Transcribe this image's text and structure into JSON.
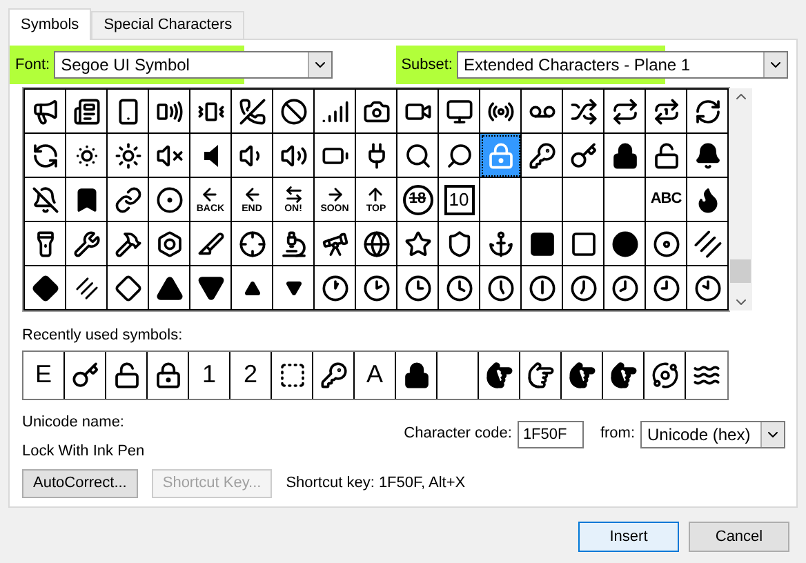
{
  "tabs": [
    {
      "label": "Symbols",
      "selected": true
    },
    {
      "label": "Special Characters",
      "selected": false
    }
  ],
  "font": {
    "label": "Font:",
    "value": "Segoe UI Symbol"
  },
  "subset": {
    "label": "Subset:",
    "value": "Extended Characters - Plane 1"
  },
  "symbol_grid": {
    "rows": [
      [
        {
          "kind": "icon",
          "selected": false
        },
        {
          "kind": "icon",
          "selected": false
        },
        {
          "kind": "icon",
          "selected": false
        },
        {
          "kind": "icon",
          "selected": false
        },
        {
          "kind": "icon",
          "selected": false
        },
        {
          "kind": "icon",
          "selected": false
        },
        {
          "kind": "icon",
          "selected": false
        },
        {
          "kind": "icon",
          "selected": false
        },
        {
          "kind": "icon",
          "selected": false
        },
        {
          "kind": "icon",
          "selected": false
        },
        {
          "kind": "icon",
          "selected": false
        },
        {
          "kind": "icon",
          "selected": false
        },
        {
          "kind": "icon",
          "selected": false
        },
        {
          "kind": "icon",
          "selected": false
        },
        {
          "kind": "icon",
          "selected": false
        },
        {
          "kind": "icon",
          "selected": false
        },
        {
          "kind": "icon",
          "selected": false
        }
      ],
      [
        {
          "kind": "icon",
          "selected": false
        },
        {
          "kind": "icon",
          "selected": false
        },
        {
          "kind": "icon",
          "selected": false
        },
        {
          "kind": "icon",
          "selected": false
        },
        {
          "kind": "icon",
          "selected": false
        },
        {
          "kind": "icon",
          "selected": false
        },
        {
          "kind": "icon",
          "selected": false
        },
        {
          "kind": "icon",
          "selected": false
        },
        {
          "kind": "icon",
          "selected": false
        },
        {
          "kind": "icon",
          "selected": false
        },
        {
          "kind": "icon",
          "selected": false
        },
        {
          "kind": "icon",
          "selected": true
        },
        {
          "kind": "icon",
          "selected": false
        },
        {
          "kind": "icon",
          "selected": false
        },
        {
          "kind": "icon",
          "selected": false
        },
        {
          "kind": "icon",
          "selected": false
        },
        {
          "kind": "icon",
          "selected": false
        }
      ],
      [
        {
          "kind": "icon",
          "selected": false
        },
        {
          "kind": "icon",
          "selected": false
        },
        {
          "kind": "icon",
          "selected": false
        },
        {
          "kind": "icon",
          "selected": false
        },
        {
          "kind": "arrow_text",
          "label": "BACK",
          "selected": false
        },
        {
          "kind": "arrow_text",
          "label": "END",
          "selected": false
        },
        {
          "kind": "arrow_text",
          "label": "ON!",
          "selected": false
        },
        {
          "kind": "arrow_text",
          "label": "SOON",
          "selected": false
        },
        {
          "kind": "arrow_text",
          "label": "TOP",
          "selected": false
        },
        {
          "kind": "circled_text",
          "label": "18",
          "selected": false
        },
        {
          "kind": "boxed_text",
          "label": "10",
          "selected": false
        },
        {
          "kind": "blank",
          "selected": false
        },
        {
          "kind": "blank",
          "selected": false
        },
        {
          "kind": "blank",
          "selected": false
        },
        {
          "kind": "blank",
          "selected": false
        },
        {
          "kind": "text",
          "label": "ABC",
          "selected": false
        },
        {
          "kind": "icon",
          "selected": false
        }
      ],
      [
        {
          "kind": "icon",
          "selected": false
        },
        {
          "kind": "icon",
          "selected": false
        },
        {
          "kind": "icon",
          "selected": false
        },
        {
          "kind": "icon",
          "selected": false
        },
        {
          "kind": "icon",
          "selected": false
        },
        {
          "kind": "icon",
          "selected": false
        },
        {
          "kind": "icon",
          "selected": false
        },
        {
          "kind": "icon",
          "selected": false
        },
        {
          "kind": "icon",
          "selected": false
        },
        {
          "kind": "icon",
          "selected": false
        },
        {
          "kind": "icon",
          "selected": false
        },
        {
          "kind": "icon",
          "selected": false
        },
        {
          "kind": "icon",
          "selected": false
        },
        {
          "kind": "icon",
          "selected": false
        },
        {
          "kind": "icon",
          "selected": false
        },
        {
          "kind": "icon",
          "selected": false
        },
        {
          "kind": "icon",
          "selected": false
        }
      ],
      [
        {
          "kind": "icon",
          "selected": false
        },
        {
          "kind": "icon",
          "selected": false
        },
        {
          "kind": "icon",
          "selected": false
        },
        {
          "kind": "icon",
          "selected": false
        },
        {
          "kind": "icon",
          "selected": false
        },
        {
          "kind": "icon",
          "selected": false
        },
        {
          "kind": "icon",
          "selected": false
        },
        {
          "kind": "icon",
          "selected": false
        },
        {
          "kind": "icon",
          "selected": false
        },
        {
          "kind": "icon",
          "selected": false
        },
        {
          "kind": "icon",
          "selected": false
        },
        {
          "kind": "icon",
          "selected": false
        },
        {
          "kind": "icon",
          "selected": false
        },
        {
          "kind": "icon",
          "selected": false
        },
        {
          "kind": "icon",
          "selected": false
        },
        {
          "kind": "icon",
          "selected": false
        },
        {
          "kind": "icon",
          "selected": false
        }
      ]
    ]
  },
  "recent": {
    "label": "Recently used symbols:",
    "cells": [
      {
        "kind": "text",
        "label": "E"
      },
      {
        "kind": "icon"
      },
      {
        "kind": "icon"
      },
      {
        "kind": "icon"
      },
      {
        "kind": "text",
        "label": "1"
      },
      {
        "kind": "text",
        "label": "2"
      },
      {
        "kind": "icon"
      },
      {
        "kind": "icon"
      },
      {
        "kind": "text",
        "label": "A"
      },
      {
        "kind": "icon"
      },
      {
        "kind": "blank"
      },
      {
        "kind": "icon"
      },
      {
        "kind": "icon"
      },
      {
        "kind": "icon"
      },
      {
        "kind": "icon"
      },
      {
        "kind": "icon"
      },
      {
        "kind": "icon"
      }
    ]
  },
  "unicode_name": {
    "label": "Unicode name:",
    "value": "Lock With Ink Pen"
  },
  "character_code": {
    "label": "Character code:",
    "value": "1F50F"
  },
  "from": {
    "label": "from:",
    "value": "Unicode (hex)"
  },
  "autocorrect_button": {
    "label": "AutoCorrect...",
    "disabled": false
  },
  "shortcut_key_button": {
    "label": "Shortcut Key...",
    "disabled": true
  },
  "shortcut_key_text": "Shortcut key: 1F50F, Alt+X",
  "buttons": [
    {
      "label": "Insert",
      "selected": true
    },
    {
      "label": "Cancel",
      "selected": false
    }
  ]
}
